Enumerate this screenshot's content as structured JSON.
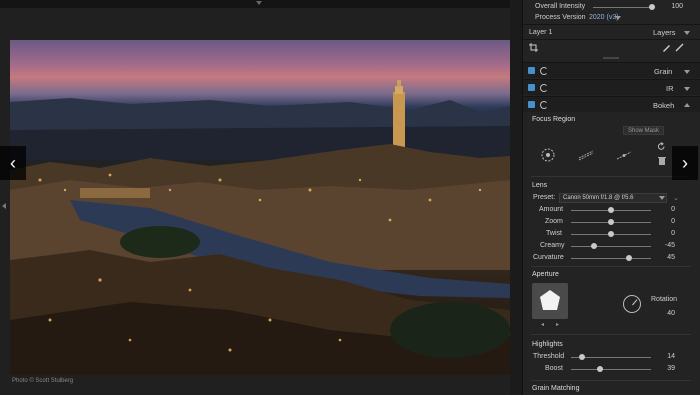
{
  "photo_credit": "Photo © Scott Stulberg",
  "panel": {
    "overall_intensity": {
      "label": "Overall Intensity",
      "value": "100",
      "level": 1.0
    },
    "process_version": {
      "label": "Process Version",
      "value": "2020 (v3)"
    },
    "layer": {
      "label": "Layer 1",
      "layers_label": "Layers"
    },
    "filters": [
      {
        "label": "Grain"
      },
      {
        "label": "IR"
      },
      {
        "label": "Bokeh"
      }
    ],
    "focus_region": {
      "title": "Focus Region",
      "show_mask": "Show Mask"
    },
    "lens": {
      "title": "Lens",
      "preset_label": "Preset:",
      "preset_value": "Canon 50mm f/1.8 @ f/5.6",
      "sliders": [
        {
          "label": "Amount",
          "value": "0",
          "level": 0.5
        },
        {
          "label": "Zoom",
          "value": "0",
          "level": 0.5
        },
        {
          "label": "Twist",
          "value": "0",
          "level": 0.5
        },
        {
          "label": "Creamy",
          "value": "-45",
          "level": 0.27
        },
        {
          "label": "Curvature",
          "value": "45",
          "level": 0.73
        }
      ]
    },
    "aperture": {
      "title": "Aperture",
      "rotation_label": "Rotation",
      "rotation_value": "40"
    },
    "highlights": {
      "title": "Highlights",
      "sliders": [
        {
          "label": "Threshold",
          "value": "14",
          "level": 0.12
        },
        {
          "label": "Boost",
          "value": "39",
          "level": 0.35
        }
      ]
    },
    "grain_matching": {
      "title": "Grain Matching"
    }
  },
  "colors": {
    "accent_blue": "#4a90c8",
    "panel_bg": "#232323"
  },
  "icons": [
    "crop-icon",
    "brush-icon",
    "eye-icon",
    "reset-icon",
    "chevron-icon"
  ]
}
